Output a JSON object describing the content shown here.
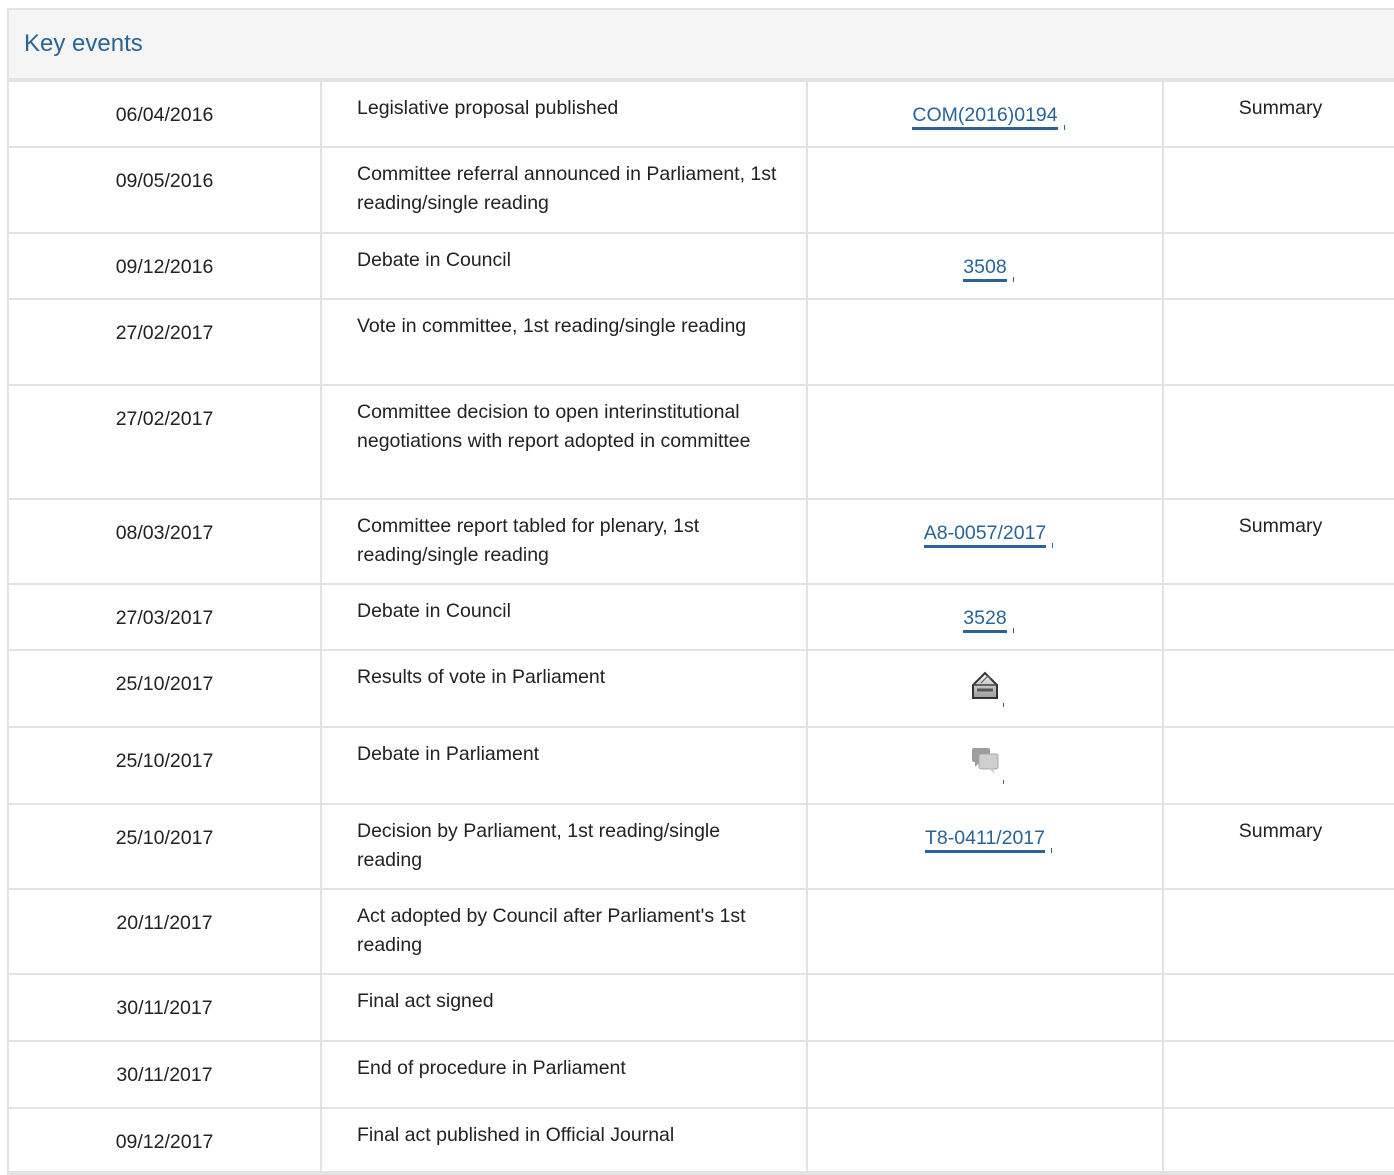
{
  "header": {
    "title": "Key events"
  },
  "events": [
    {
      "date": "06/04/2016",
      "event": "Legislative proposal published",
      "doc": "COM(2016)0194",
      "summary": "Summary"
    },
    {
      "date": "09/05/2016",
      "event": "Committee referral announced in Parliament, 1st reading/single reading",
      "doc": "",
      "summary": ""
    },
    {
      "date": "09/12/2016",
      "event": "Debate in Council",
      "doc": "3508",
      "summary": ""
    },
    {
      "date": "27/02/2017",
      "event": "Vote in committee, 1st reading/single reading",
      "doc": "",
      "summary": ""
    },
    {
      "date": "27/02/2017",
      "event": "Committee decision to open interinstitutional negotiations with report adopted in committee",
      "doc": "",
      "summary": ""
    },
    {
      "date": "08/03/2017",
      "event": "Committee report tabled for plenary, 1st reading/single reading",
      "doc": "A8-0057/2017",
      "summary": "Summary"
    },
    {
      "date": "27/03/2017",
      "event": "Debate in Council",
      "doc": "3528",
      "summary": ""
    },
    {
      "date": "25/10/2017",
      "event": "Results of vote in Parliament",
      "doc_icon": "ballot-box-icon",
      "summary": ""
    },
    {
      "date": "25/10/2017",
      "event": "Debate in Parliament",
      "doc_icon": "speech-bubbles-icon",
      "summary": ""
    },
    {
      "date": "25/10/2017",
      "event": "Decision by Parliament, 1st reading/single reading",
      "doc": "T8-0411/2017",
      "summary": "Summary"
    },
    {
      "date": "20/11/2017",
      "event": "Act adopted by Council after Parliament's 1st reading",
      "doc": "",
      "summary": ""
    },
    {
      "date": "30/11/2017",
      "event": "Final act signed",
      "doc": "",
      "summary": ""
    },
    {
      "date": "30/11/2017",
      "event": "End of procedure in Parliament",
      "doc": "",
      "summary": ""
    },
    {
      "date": "09/12/2017",
      "event": "Final act published in Official Journal",
      "doc": "",
      "summary": ""
    }
  ],
  "colors": {
    "link": "#2a6496",
    "border": "#e3e3e3",
    "header_bg": "#f5f5f5"
  }
}
